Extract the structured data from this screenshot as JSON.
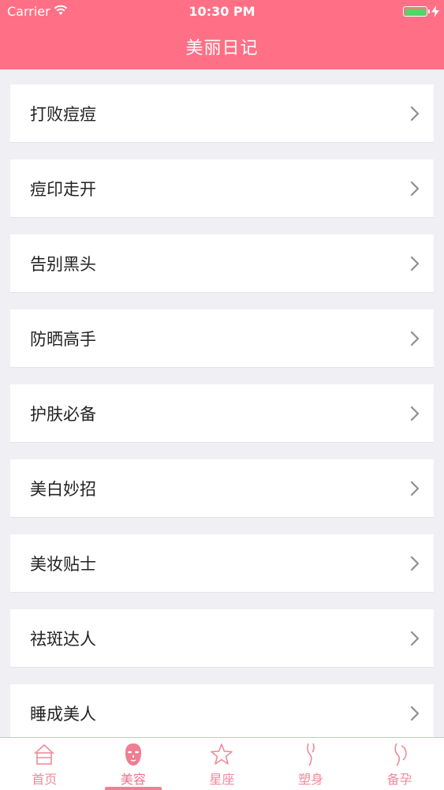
{
  "status_bar": {
    "carrier": "Carrier",
    "time": "10:30 PM",
    "battery_level": 1.0
  },
  "nav": {
    "title": "美丽日记"
  },
  "list": {
    "items": [
      {
        "label": "打败痘痘"
      },
      {
        "label": "痘印走开"
      },
      {
        "label": "告别黑头"
      },
      {
        "label": "防晒高手"
      },
      {
        "label": "护肤必备"
      },
      {
        "label": "美白妙招"
      },
      {
        "label": "美妆贴士"
      },
      {
        "label": "祛斑达人"
      },
      {
        "label": "睡成美人"
      }
    ]
  },
  "tabs": [
    {
      "label": "首页",
      "icon": "home-icon"
    },
    {
      "label": "美容",
      "icon": "face-mask-icon",
      "active": true
    },
    {
      "label": "星座",
      "icon": "star-icon"
    },
    {
      "label": "塑身",
      "icon": "body-shape-icon"
    },
    {
      "label": "备孕",
      "icon": "pregnancy-icon"
    }
  ],
  "colors": {
    "accent": "#ff6f86",
    "tab_text": "#f08a9b",
    "background": "#efeff4"
  }
}
